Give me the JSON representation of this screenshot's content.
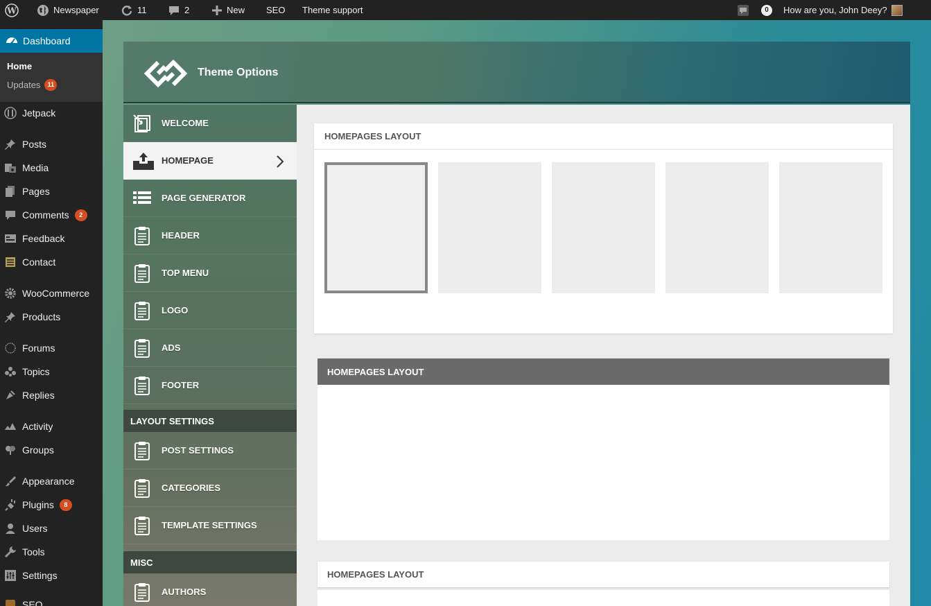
{
  "adminbar": {
    "site_name": "Newspaper",
    "updates_count": "11",
    "comments_count": "2",
    "new_label": "New",
    "seo_label": "SEO",
    "theme_support_label": "Theme support",
    "notifications_count": "0",
    "greeting": "How are you, John Deey?"
  },
  "sidebar": {
    "dashboard": "Dashboard",
    "sub": {
      "home": "Home",
      "updates": "Updates",
      "updates_badge": "11"
    },
    "items": [
      {
        "label": "Jetpack",
        "icon": "jetpack-icon"
      },
      {
        "label": "Posts",
        "icon": "pin-icon"
      },
      {
        "label": "Media",
        "icon": "media-icon"
      },
      {
        "label": "Pages",
        "icon": "pages-icon"
      },
      {
        "label": "Comments",
        "icon": "comment-icon",
        "badge": "2"
      },
      {
        "label": "Feedback",
        "icon": "feedback-icon"
      },
      {
        "label": "Contact",
        "icon": "contact-icon"
      },
      {
        "label": "WooCommerce",
        "icon": "gear-icon"
      },
      {
        "label": "Products",
        "icon": "pin-icon"
      },
      {
        "label": "Forums",
        "icon": "forums-icon"
      },
      {
        "label": "Topics",
        "icon": "topics-icon"
      },
      {
        "label": "Replies",
        "icon": "replies-icon"
      },
      {
        "label": "Activity",
        "icon": "activity-icon"
      },
      {
        "label": "Groups",
        "icon": "groups-icon"
      },
      {
        "label": "Appearance",
        "icon": "brush-icon"
      },
      {
        "label": "Plugins",
        "icon": "plugin-icon",
        "badge": "8"
      },
      {
        "label": "Users",
        "icon": "user-icon"
      },
      {
        "label": "Tools",
        "icon": "wrench-icon"
      },
      {
        "label": "Settings",
        "icon": "settings-icon"
      },
      {
        "label": "SEO",
        "icon": "seo-icon"
      }
    ]
  },
  "theme": {
    "title": "Theme Options",
    "nav": [
      {
        "label": "WELCOME",
        "icon": "welcome-icon"
      },
      {
        "label": "HOMEPAGE",
        "icon": "inbox-upload-icon",
        "active": true
      },
      {
        "label": "PAGE GENERATOR",
        "icon": "list-icon"
      },
      {
        "label": "HEADER",
        "icon": "clipboard-icon"
      },
      {
        "label": "TOP MENU",
        "icon": "clipboard-icon"
      },
      {
        "label": "LOGO",
        "icon": "clipboard-icon"
      },
      {
        "label": "ADS",
        "icon": "clipboard-icon"
      },
      {
        "label": "FOOTER",
        "icon": "clipboard-icon"
      }
    ],
    "sections": {
      "layout_settings": "LAYOUT SETTINGS",
      "layout_items": [
        "POST SETTINGS",
        "CATEGORIES",
        "TEMPLATE SETTINGS"
      ],
      "misc": "MISC",
      "misc_items": [
        "AUTHORS"
      ]
    },
    "cards": {
      "layout_title_1": "HOMEPAGES LAYOUT",
      "layout_title_2": "HOMEPAGES LAYOUT",
      "layout_title_3": "HOMEPAGES LAYOUT"
    }
  },
  "colors": {
    "admin_bar": "#222222",
    "dashboard_active": "#0074a2",
    "badge": "#d54e21",
    "dark_header": "#6a6a6a"
  }
}
